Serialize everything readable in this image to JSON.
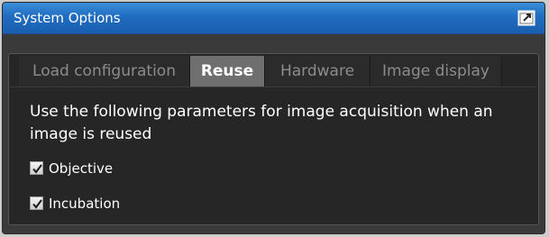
{
  "window": {
    "title": "System Options",
    "undock_icon": "undock-icon"
  },
  "tabs": [
    {
      "label": "Load configuration",
      "active": false
    },
    {
      "label": "Reuse",
      "active": true
    },
    {
      "label": "Hardware",
      "active": false
    },
    {
      "label": "Image display",
      "active": false
    }
  ],
  "reuse": {
    "description": "Use the following parameters for image acquisition when an image is reused",
    "options": [
      {
        "label": "Objective",
        "checked": true
      },
      {
        "label": "Incubation",
        "checked": true
      }
    ]
  },
  "colors": {
    "titlebar": "#1f6cc0",
    "panel_bg": "#262626",
    "active_tab": "#6f6f6f",
    "inactive_tab_text": "#8c8c8c"
  }
}
